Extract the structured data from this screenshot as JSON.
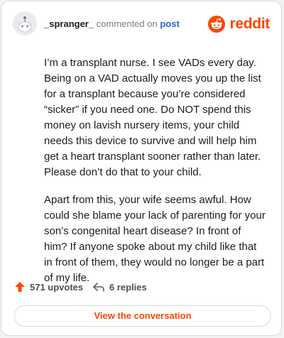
{
  "comment": {
    "username": "_spranger_",
    "action_text": "commented on",
    "post_link": "post",
    "brand": "reddit",
    "paragraphs": [
      "I’m a transplant nurse. I see VADs every day. Being on a VAD actually moves you up the list for a transplant because you’re considered “sicker” if you need one. Do NOT spend this money on lavish nursery items, your child needs this device to survive and will help him get a heart transplant sooner rather than later. Please don’t do that to your child.",
      "Apart from this, your wife seems awful. How could she blame your lack of parenting for your son’s congenital heart disease? In front of him? If anyone spoke about my child like that in front of them, they would no longer be a part of my life."
    ]
  },
  "footer": {
    "upvotes": "571 upvotes",
    "replies": "6 replies",
    "cta": "View the conversation"
  },
  "colors": {
    "accent": "#ff4500",
    "link": "#2a64c5",
    "text": "#1c1c1c"
  }
}
